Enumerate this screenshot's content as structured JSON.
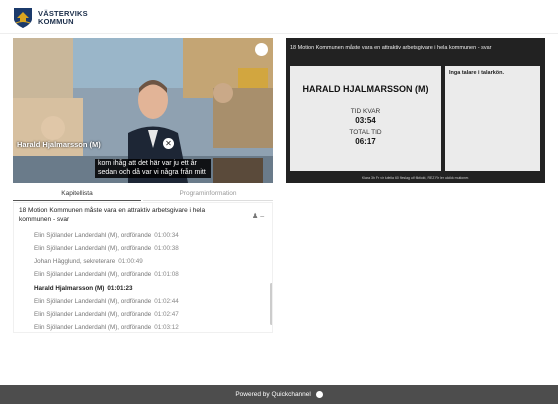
{
  "header": {
    "org_line1": "VÄSTERVIKS",
    "org_line2": "KOMMUN"
  },
  "video": {
    "speaker_label": "Harald Hjalmarsson (M)",
    "subtitle": "kom ihåg att det här var ju ett år sedan och då var vi några från mitt",
    "close_icon": "close-icon",
    "badge_icon": "quickchannel-icon"
  },
  "slide": {
    "title": "18 Motion Kommunen måste vara en attraktiv arbetsgivare i hela kommunen - svar",
    "speaker_name": "HARALD HJALMARSSON (M)",
    "time_left_label": "TID KVAR",
    "time_left_value": "03:54",
    "total_time_label": "TOTAL TID",
    "total_time_value": "06:17",
    "side_text": "Inga talare i talarkön.",
    "footer_text": "Klara 3h Fr vir lufelia 60 fleslag ulf fiktiokt, REZ Rr ler ulcikk mutioner."
  },
  "tabs": {
    "active": "Kapitellista",
    "inactive": "Programinformation"
  },
  "chapter": {
    "title": "18 Motion Kommunen måste vara en attraktiv arbetsgivare i hela kommunen - svar",
    "icons": [
      "user-icon",
      "collapse-icon"
    ],
    "rows": [
      {
        "name": "Elin Sjölander Landerdahl (M), ordförande",
        "time": "01:00:34"
      },
      {
        "name": "Elin Sjölander Landerdahl (M), ordförande",
        "time": "01:00:38"
      },
      {
        "name": "Johan Hägglund, sekreterare",
        "time": "01:00:49"
      },
      {
        "name": "Elin Sjölander Landerdahl (M), ordförande",
        "time": "01:01:08"
      },
      {
        "name": "Harald Hjalmarsson (M)",
        "time": "01:01:23"
      },
      {
        "name": "Elin Sjölander Landerdahl (M), ordförande",
        "time": "01:02:44"
      },
      {
        "name": "Elin Sjölander Landerdahl (M), ordförande",
        "time": "01:02:47"
      },
      {
        "name": "Elin Sjölander Landerdahl (M), ordförande",
        "time": "01:03:12"
      }
    ],
    "current_index": 4
  },
  "footer": {
    "text": "Powered by Quickchannel",
    "icon": "quickchannel-icon"
  },
  "colors": {
    "footer_bg": "#4d4d4d",
    "logo_blue": "#1b3a6b",
    "logo_gold": "#d9a520"
  }
}
